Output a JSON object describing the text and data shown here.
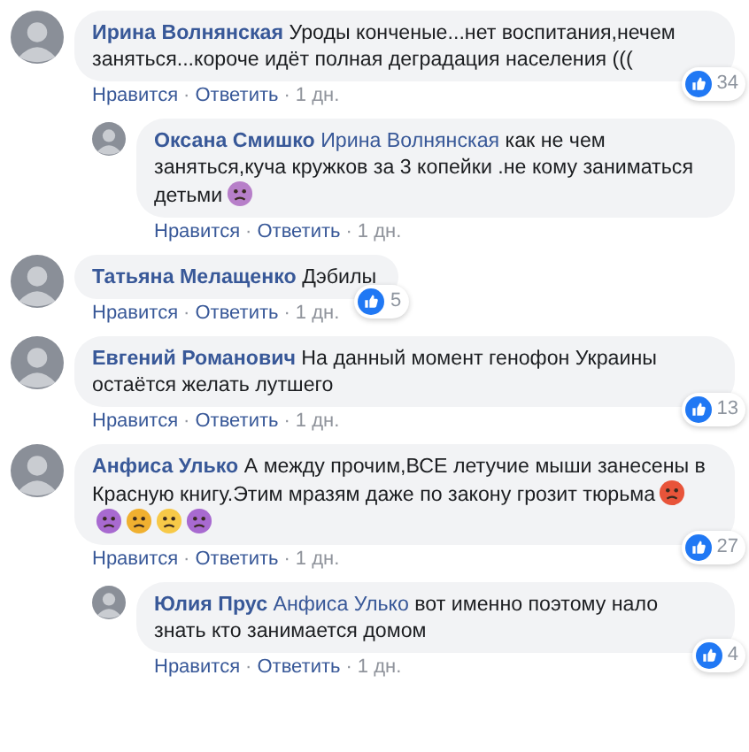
{
  "comments": [
    {
      "author": "Ирина Волнянская",
      "text": "Уроды конченые...нет воспитания,нечем заняться...короче идёт полная деградация населения (((",
      "likes": "34",
      "actions": [
        {
          "kind": "link",
          "label": "Нравится"
        },
        {
          "kind": "sep",
          "label": "·"
        },
        {
          "kind": "link",
          "label": "Ответить"
        },
        {
          "kind": "sep",
          "label": "·"
        },
        {
          "kind": "time",
          "label": "1 дн."
        }
      ],
      "children": [
        {
          "author": "Оксана Смишко",
          "mention": "Ирина Волнянская",
          "text": "как не чем заняться,куча кружков за 3 копейки .не кому заниматься детьми",
          "emojis": [
            {
              "color": "#b77fc9"
            }
          ],
          "actions": [
            {
              "kind": "link",
              "label": "Нравится"
            },
            {
              "kind": "sep",
              "label": "·"
            },
            {
              "kind": "link",
              "label": "Ответить"
            },
            {
              "kind": "sep",
              "label": "·"
            },
            {
              "kind": "time",
              "label": "1 дн."
            }
          ]
        }
      ]
    },
    {
      "author": "Татьяна Мелащенко",
      "text": "Дэбилы",
      "likes": "5",
      "actions": [
        {
          "kind": "link",
          "label": "Нравится"
        },
        {
          "kind": "sep",
          "label": "·"
        },
        {
          "kind": "link",
          "label": "Ответить"
        },
        {
          "kind": "sep",
          "label": "·"
        },
        {
          "kind": "time",
          "label": "1 дн."
        }
      ]
    },
    {
      "author": "Евгений Романович",
      "text": "На данный момент генофон Украины остаётся желать лутшего",
      "likes": "13",
      "actions": [
        {
          "kind": "link",
          "label": "Нравится"
        },
        {
          "kind": "sep",
          "label": "·"
        },
        {
          "kind": "link",
          "label": "Ответить"
        },
        {
          "kind": "sep",
          "label": "·"
        },
        {
          "kind": "time",
          "label": "1 дн."
        }
      ]
    },
    {
      "author": "Анфиса Улько",
      "text": "А между прочим,ВСЕ летучие мыши занесены в Красную книгу.Этим мразям даже по закону грозит тюрьма",
      "emojis": [
        {
          "color": "#e8543a"
        },
        {
          "color": "#a86ad0"
        },
        {
          "color": "#f0b030"
        },
        {
          "color": "#f7c948"
        },
        {
          "color": "#a86ad0"
        }
      ],
      "likes": "27",
      "actions": [
        {
          "kind": "link",
          "label": "Нравится"
        },
        {
          "kind": "sep",
          "label": "·"
        },
        {
          "kind": "link",
          "label": "Ответить"
        },
        {
          "kind": "sep",
          "label": "·"
        },
        {
          "kind": "time",
          "label": "1 дн."
        }
      ],
      "children": [
        {
          "author": "Юлия Прус",
          "mention": "Анфиса Улько",
          "text": "вот именно поэтому нало знать кто занимается домом",
          "likes": "4",
          "actions": [
            {
              "kind": "link",
              "label": "Нравится"
            },
            {
              "kind": "sep",
              "label": "·"
            },
            {
              "kind": "link",
              "label": "Ответить"
            },
            {
              "kind": "sep",
              "label": "·"
            },
            {
              "kind": "time",
              "label": "1 дн."
            }
          ]
        }
      ]
    }
  ]
}
